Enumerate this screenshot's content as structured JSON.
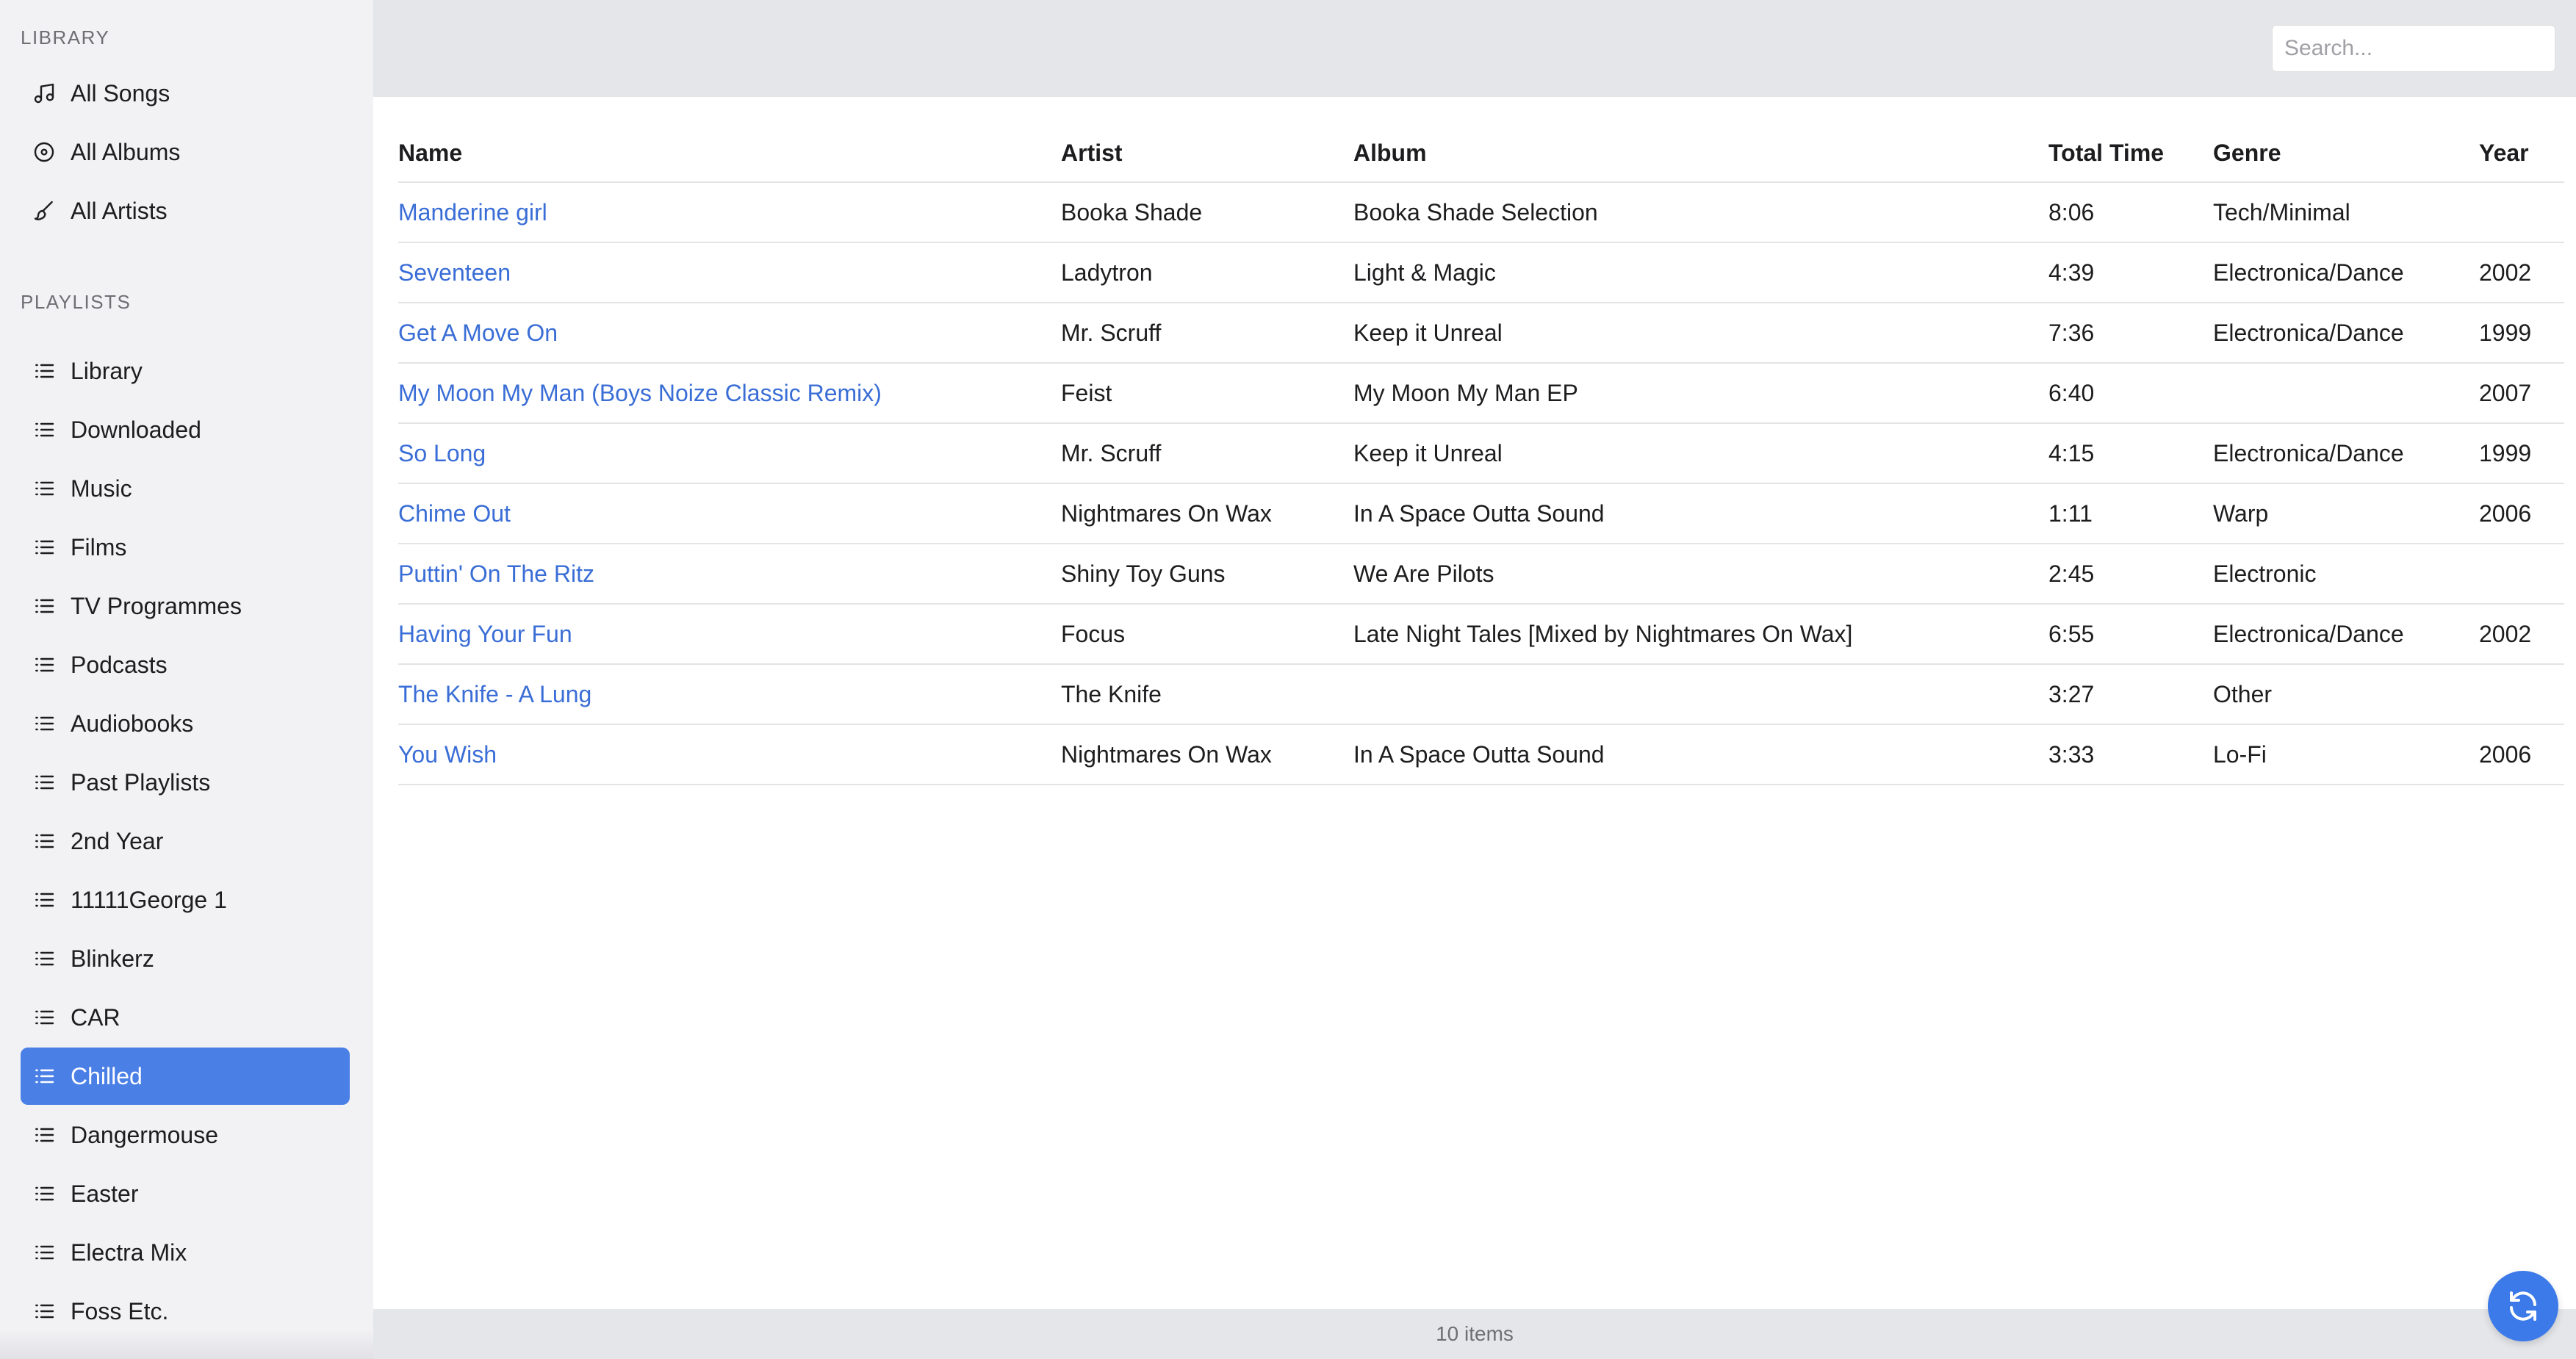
{
  "sidebar": {
    "library_heading": "LIBRARY",
    "library_items": [
      {
        "label": "All Songs",
        "icon": "music-note-icon"
      },
      {
        "label": "All Albums",
        "icon": "disc-icon"
      },
      {
        "label": "All Artists",
        "icon": "brush-icon"
      }
    ],
    "playlists_heading": "PLAYLISTS",
    "playlist_items": [
      {
        "label": "Library"
      },
      {
        "label": "Downloaded"
      },
      {
        "label": "Music"
      },
      {
        "label": "Films"
      },
      {
        "label": "TV Programmes"
      },
      {
        "label": "Podcasts"
      },
      {
        "label": "Audiobooks"
      },
      {
        "label": "Past Playlists"
      },
      {
        "label": "2nd Year"
      },
      {
        "label": "11111George 1"
      },
      {
        "label": "Blinkerz"
      },
      {
        "label": "CAR"
      },
      {
        "label": "Chilled"
      },
      {
        "label": "Dangermouse"
      },
      {
        "label": "Easter"
      },
      {
        "label": "Electra Mix"
      },
      {
        "label": "Foss Etc."
      }
    ],
    "active_playlist": "Chilled",
    "accent_color": "#4a7fe6"
  },
  "header": {
    "search_placeholder": "Search...",
    "search_value": ""
  },
  "table": {
    "columns": [
      "Name",
      "Artist",
      "Album",
      "Total Time",
      "Genre",
      "Year"
    ],
    "rows": [
      {
        "name": "Manderine girl",
        "artist": "Booka Shade",
        "album": "Booka Shade Selection",
        "time": "8:06",
        "genre": "Tech/Minimal",
        "year": ""
      },
      {
        "name": "Seventeen",
        "artist": "Ladytron",
        "album": "Light & Magic",
        "time": "4:39",
        "genre": "Electronica/Dance",
        "year": "2002"
      },
      {
        "name": "Get A Move On",
        "artist": "Mr. Scruff",
        "album": "Keep it Unreal",
        "time": "7:36",
        "genre": "Electronica/Dance",
        "year": "1999"
      },
      {
        "name": "My Moon My Man (Boys Noize Classic Remix)",
        "artist": "Feist",
        "album": "My Moon My Man EP",
        "time": "6:40",
        "genre": "",
        "year": "2007"
      },
      {
        "name": "So Long",
        "artist": "Mr. Scruff",
        "album": "Keep it Unreal",
        "time": "4:15",
        "genre": "Electronica/Dance",
        "year": "1999"
      },
      {
        "name": "Chime Out",
        "artist": "Nightmares On Wax",
        "album": "In A Space Outta Sound",
        "time": "1:11",
        "genre": "Warp",
        "year": "2006"
      },
      {
        "name": "Puttin' On The Ritz",
        "artist": "Shiny Toy Guns",
        "album": "We Are Pilots",
        "time": "2:45",
        "genre": "Electronic",
        "year": ""
      },
      {
        "name": "Having Your Fun",
        "artist": "Focus",
        "album": "Late Night Tales [Mixed by Nightmares On Wax]",
        "time": "6:55",
        "genre": "Electronica/Dance",
        "year": "2002"
      },
      {
        "name": "The Knife - A Lung",
        "artist": "The Knife",
        "album": "",
        "time": "3:27",
        "genre": "Other",
        "year": ""
      },
      {
        "name": "You Wish",
        "artist": "Nightmares On Wax",
        "album": "In A Space Outta Sound",
        "time": "3:33",
        "genre": "Lo-Fi",
        "year": "2006"
      }
    ]
  },
  "footer": {
    "item_count": "10 items"
  },
  "refresh": {
    "icon": "refresh-icon"
  }
}
